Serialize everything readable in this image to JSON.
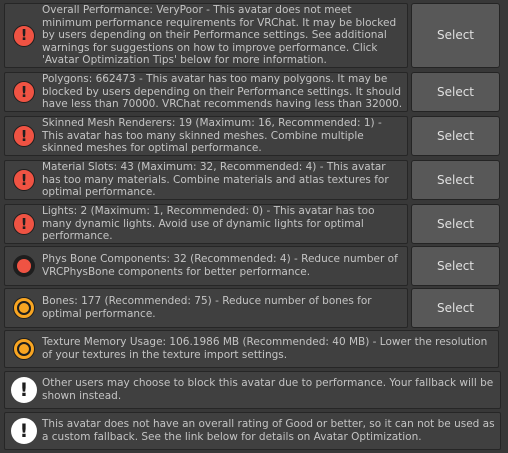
{
  "select_label": "Select",
  "messages": [
    {
      "text": "Overall Performance: VeryPoor - This avatar does not meet minimum performance requirements for VRChat. It may be blocked by users depending on their Performance settings. See additional warnings for suggestions on how to improve performance. Click 'Avatar Optimization Tips' below for more information.",
      "icon": "error-icon",
      "has_button": true
    },
    {
      "text": "Polygons: 662473 - This avatar has too many polygons. It may be blocked by users depending on their Performance settings. It should have less than 70000. VRChat recommends having less than 32000.",
      "icon": "error-icon",
      "has_button": true
    },
    {
      "text": "Skinned Mesh Renderers: 19 (Maximum: 16, Recommended: 1) - This avatar has too many skinned meshes. Combine multiple skinned meshes for optimal performance.",
      "icon": "error-icon",
      "has_button": true
    },
    {
      "text": "Material Slots: 43 (Maximum: 32, Recommended: 4) - This avatar has too many materials. Combine materials and atlas textures for optimal performance.",
      "icon": "error-icon",
      "has_button": true
    },
    {
      "text": "Lights: 2 (Maximum: 1, Recommended: 0) - This avatar has too many dynamic lights. Avoid use of dynamic lights for optimal performance.",
      "icon": "error-icon",
      "has_button": true
    },
    {
      "text": "Phys Bone Components: 32 (Recommended: 4) - Reduce number of VRCPhysBone components for better performance.",
      "icon": "poor-circle-icon",
      "has_button": true
    },
    {
      "text": "Bones: 177 (Recommended: 75) - Reduce number of bones for optimal performance.",
      "icon": "medium-circle-icon",
      "has_button": true
    },
    {
      "text": "Texture Memory Usage: 106.1986 MB (Recommended: 40 MB) - Lower the resolution of your textures in the texture import settings.",
      "icon": "medium-circle-icon",
      "has_button": false
    },
    {
      "text": "Other users may choose to block this avatar due to performance. Your fallback will be shown instead.",
      "icon": "info-icon",
      "has_button": false
    },
    {
      "text": "This avatar does not have an overall rating of Good or better, so it can not be used as a custom fallback. See the link below for details on Avatar Optimization.",
      "icon": "info-icon",
      "has_button": false
    }
  ],
  "colors": {
    "error": "#ef5343",
    "medium": "#f8a522",
    "info": "#ffffff",
    "panel": "#404040",
    "button": "#585858"
  }
}
